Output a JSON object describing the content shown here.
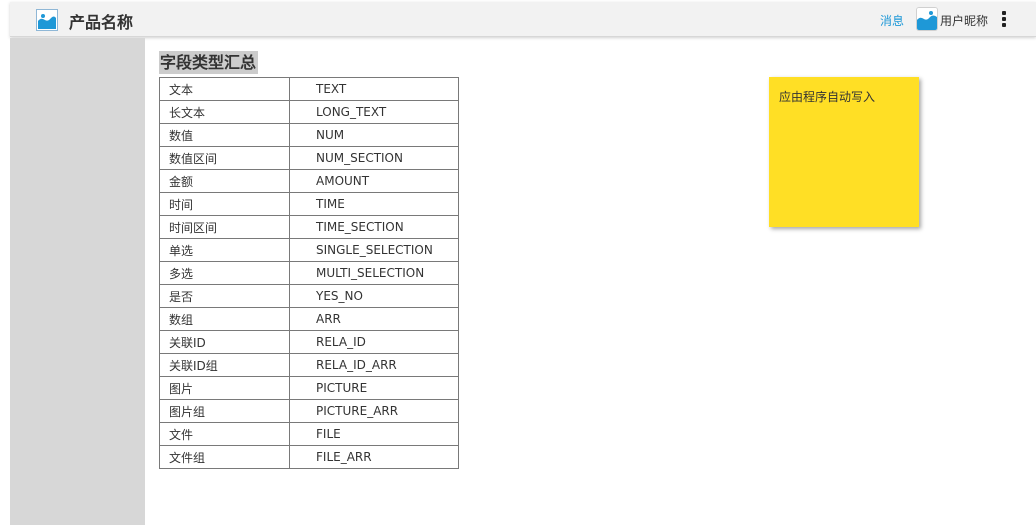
{
  "header": {
    "logo_icon": "image-icon",
    "product_name": "产品名称",
    "messages_label": "消息",
    "avatar_icon": "image-icon",
    "nickname": "用户昵称",
    "more_icon": "more-vertical-icon",
    "accent_color": "#1e98d7"
  },
  "main": {
    "section_title": "字段类型汇总",
    "field_types": [
      {
        "name": "文本",
        "code": "TEXT"
      },
      {
        "name": "长文本",
        "code": "LONG_TEXT"
      },
      {
        "name": "数值",
        "code": "NUM"
      },
      {
        "name": "数值区间",
        "code": "NUM_SECTION"
      },
      {
        "name": "金额",
        "code": "AMOUNT"
      },
      {
        "name": "时间",
        "code": "TIME"
      },
      {
        "name": "时间区间",
        "code": "TIME_SECTION"
      },
      {
        "name": "单选",
        "code": "SINGLE_SELECTION"
      },
      {
        "name": "多选",
        "code": "MULTI_SELECTION"
      },
      {
        "name": "是否",
        "code": "YES_NO"
      },
      {
        "name": "数组",
        "code": "ARR"
      },
      {
        "name": "关联ID",
        "code": "RELA_ID"
      },
      {
        "name": "关联ID组",
        "code": "RELA_ID_ARR"
      },
      {
        "name": "图片",
        "code": "PICTURE"
      },
      {
        "name": "图片组",
        "code": "PICTURE_ARR"
      },
      {
        "name": "文件",
        "code": "FILE"
      },
      {
        "name": "文件组",
        "code": "FILE_ARR"
      }
    ]
  },
  "sticky_note": {
    "text": "应由程序自动写入",
    "color": "#ffdf25"
  }
}
